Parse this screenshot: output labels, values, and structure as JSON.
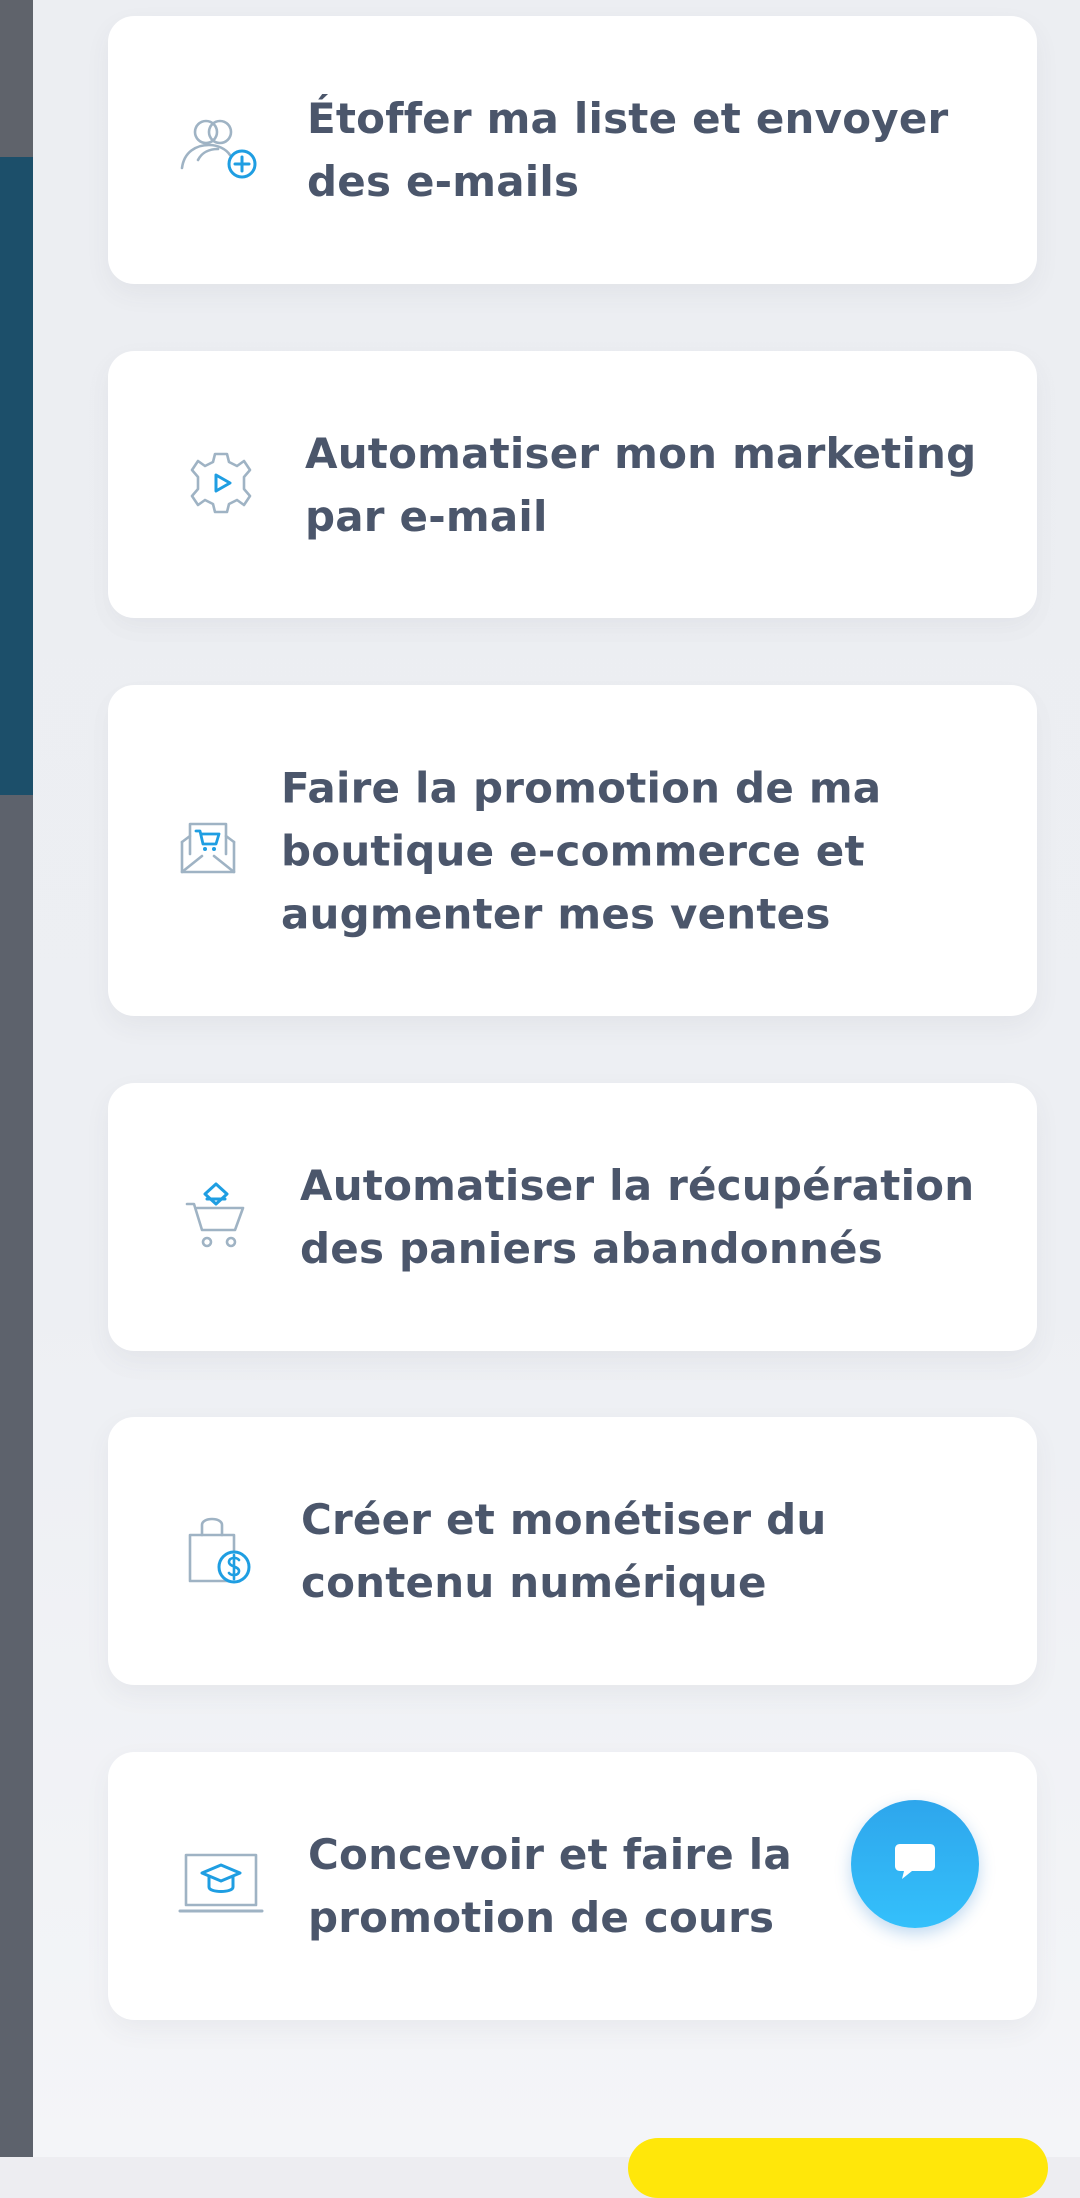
{
  "goals": [
    {
      "icon": "user-add-icon",
      "label": "Étoffer ma liste et envoyer des e-mails",
      "line1": "Étoffer ma liste et envoyer",
      "line2": "des e-mails"
    },
    {
      "icon": "gear-play-icon",
      "label": "Automatiser mon marketing par e-mail",
      "line1": "Automatiser mon marketing",
      "line2": "par e-mail"
    },
    {
      "icon": "envelope-cart-icon",
      "label": "Faire la promotion de ma boutique e-commerce et augmenter mes ventes",
      "line1": "Faire la promotion de ma",
      "line2": "boutique e-commerce et",
      "line3": "augmenter mes ventes"
    },
    {
      "icon": "cart-recovery-icon",
      "label": "Automatiser la récupération des paniers abandonnés",
      "line1": "Automatiser la récupération",
      "line2": "des paniers abandonnés"
    },
    {
      "icon": "shopping-bag-dollar-icon",
      "label": "Créer et monétiser du contenu numérique",
      "line1": "Créer et monétiser du",
      "line2": "contenu numérique"
    },
    {
      "icon": "laptop-graduation-icon",
      "label": "Concevoir et faire la promotion de cours",
      "line1": "Concevoir et faire la",
      "line2": "promotion de cours"
    }
  ],
  "colors": {
    "text": "#4b566b",
    "icon_outline": "#9fb3c4",
    "icon_accent": "#1f9ee2",
    "chat_button": "#2ea6ec",
    "cta_yellow": "#ffe70a",
    "left_accent": "#1c4f6a"
  },
  "chat": {
    "icon": "chat-bubble-icon"
  }
}
